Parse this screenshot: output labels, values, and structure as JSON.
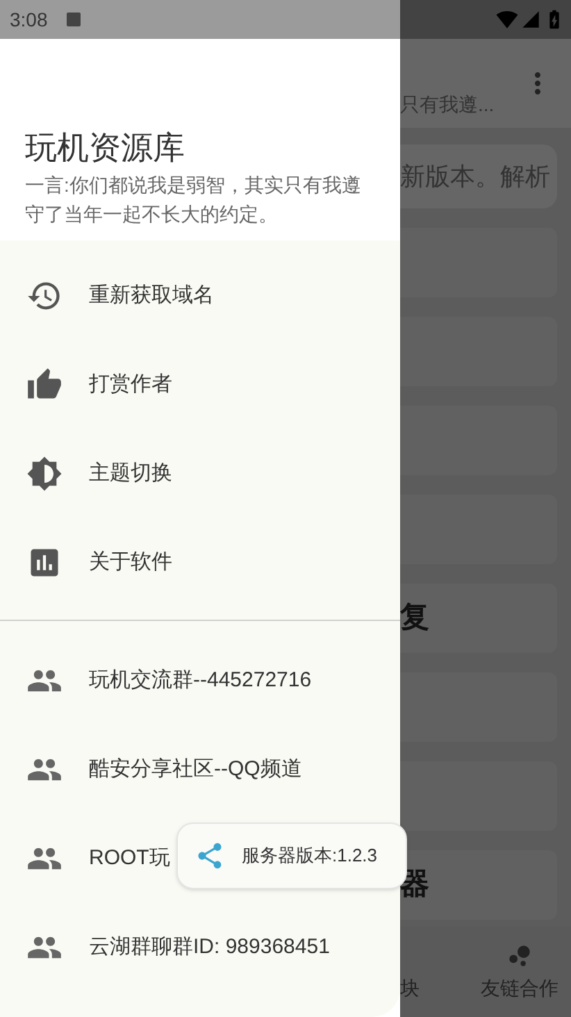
{
  "status_bar": {
    "time": "3:08"
  },
  "drawer": {
    "title": "玩机资源库",
    "quote": "一言:你们都说我是弱智，其实只有我遵守了当年一起不长大的约定。",
    "items": [
      {
        "label": "重新获取域名"
      },
      {
        "label": "打赏作者"
      },
      {
        "label": "主题切换"
      },
      {
        "label": "关于软件"
      }
    ],
    "groups": [
      {
        "label": "玩机交流群--445272716"
      },
      {
        "label": "酷安分享社区--QQ频道"
      },
      {
        "label": "ROOT玩"
      },
      {
        "label": "云湖群聊群ID: 989368451"
      }
    ]
  },
  "background_app": {
    "subtitle": "只有我遵...",
    "cards": [
      {
        "kind": "text",
        "title": "新版本。解析"
      },
      {
        "kind": "blank"
      },
      {
        "kind": "blank"
      },
      {
        "kind": "blank"
      },
      {
        "kind": "blank"
      },
      {
        "kind": "heading",
        "title": "复"
      },
      {
        "kind": "blank"
      },
      {
        "kind": "blank"
      },
      {
        "kind": "heading",
        "title": "器"
      }
    ],
    "bottom_nav": [
      {
        "label": "块"
      },
      {
        "label": "友链合作"
      }
    ]
  },
  "toast": {
    "text": "服务器版本:1.2.3"
  }
}
